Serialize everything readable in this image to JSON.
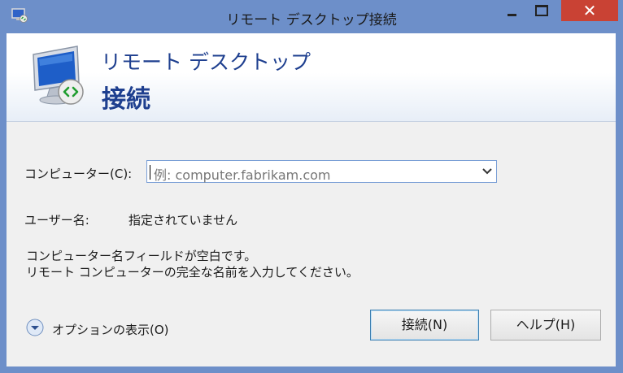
{
  "window": {
    "title": "リモート デスクトップ接続",
    "close_glyph": "✕"
  },
  "banner": {
    "title": "リモート デスクトップ",
    "subtitle": "接続"
  },
  "form": {
    "computer_label": "コンピューター(C):",
    "computer_placeholder": "例: computer.fabrikam.com",
    "username_label": "ユーザー名:",
    "username_value": "指定されていません",
    "message_line1": "コンピューター名フィールドが空白です。",
    "message_line2": "リモート コンピューターの完全な名前を入力してください。"
  },
  "options": {
    "label": "オプションの表示(O)"
  },
  "buttons": {
    "connect": "接続(N)",
    "help": "ヘルプ(H)"
  },
  "colors": {
    "frame": "#6d8fc9",
    "close_button": "#c94234",
    "banner_text": "#1e3f8f"
  }
}
